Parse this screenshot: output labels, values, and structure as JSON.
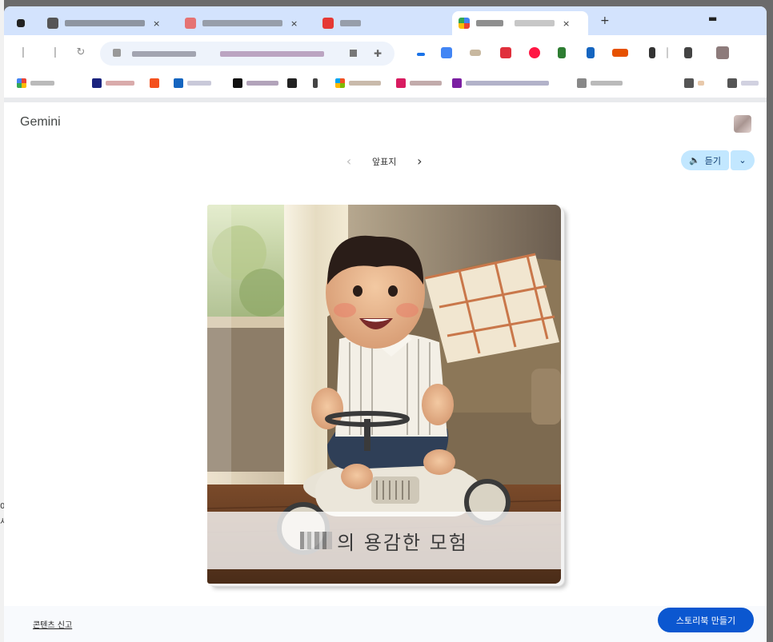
{
  "browser": {
    "tabs": [
      {
        "active": false,
        "favicon_color": "#222222"
      },
      {
        "active": false,
        "favicon_color": "#555555"
      },
      {
        "active": false,
        "favicon_color": "#e57373"
      },
      {
        "active": false,
        "favicon_color": "#e53935"
      },
      {
        "active": true,
        "favicon_color": "#4285f4"
      }
    ],
    "new_tab_label": "+"
  },
  "page": {
    "app_title": "Gemini",
    "pager": {
      "prev_label": "‹",
      "current_label": "앞표지",
      "next_label": "›"
    },
    "listen": {
      "label": "듣기",
      "icon": "speaker-icon",
      "dropdown_icon": "chevron-down-icon"
    },
    "book": {
      "title_suffix": "의 용감한 모험",
      "illustration": "toddler riding a ride-on toy car in a sunlit living room"
    },
    "footer": {
      "report_link": "콘텐츠 신고",
      "create_button": "스토리북 만들기"
    }
  },
  "colors": {
    "tabstrip_bg": "#d3e3fd",
    "listen_bg": "#c2e7ff",
    "primary_button": "#0b57d0"
  }
}
